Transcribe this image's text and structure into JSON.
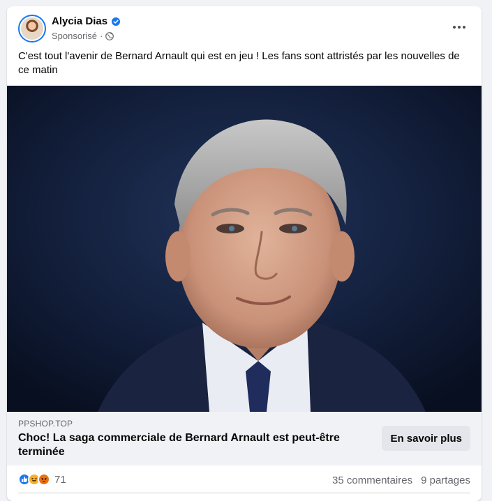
{
  "post": {
    "author": "Alycia Dias",
    "sponsored_label": "Sponsorisé",
    "separator": "·",
    "text": "C'est tout l'avenir de Bernard Arnault qui est en jeu ! Les fans sont attristés par les nouvelles de ce matin"
  },
  "link": {
    "domain": "PPSHOP.TOP",
    "title": "Choc! La saga commerciale de Bernard Arnault est peut-être terminée",
    "cta_label": "En savoir plus"
  },
  "engagement": {
    "reaction_count": "71",
    "comments": "35 commentaires",
    "shares": "9 partages"
  },
  "icons": {
    "verified": "verified-badge-icon",
    "privacy": "globe-icon",
    "more": "more-options-icon",
    "reactions": [
      "like-icon",
      "haha-icon",
      "angry-icon"
    ]
  },
  "colors": {
    "accent": "#1877f2",
    "secondary_text": "#65676b",
    "link_bar_bg": "#f0f2f5",
    "button_bg": "#e4e6eb"
  }
}
